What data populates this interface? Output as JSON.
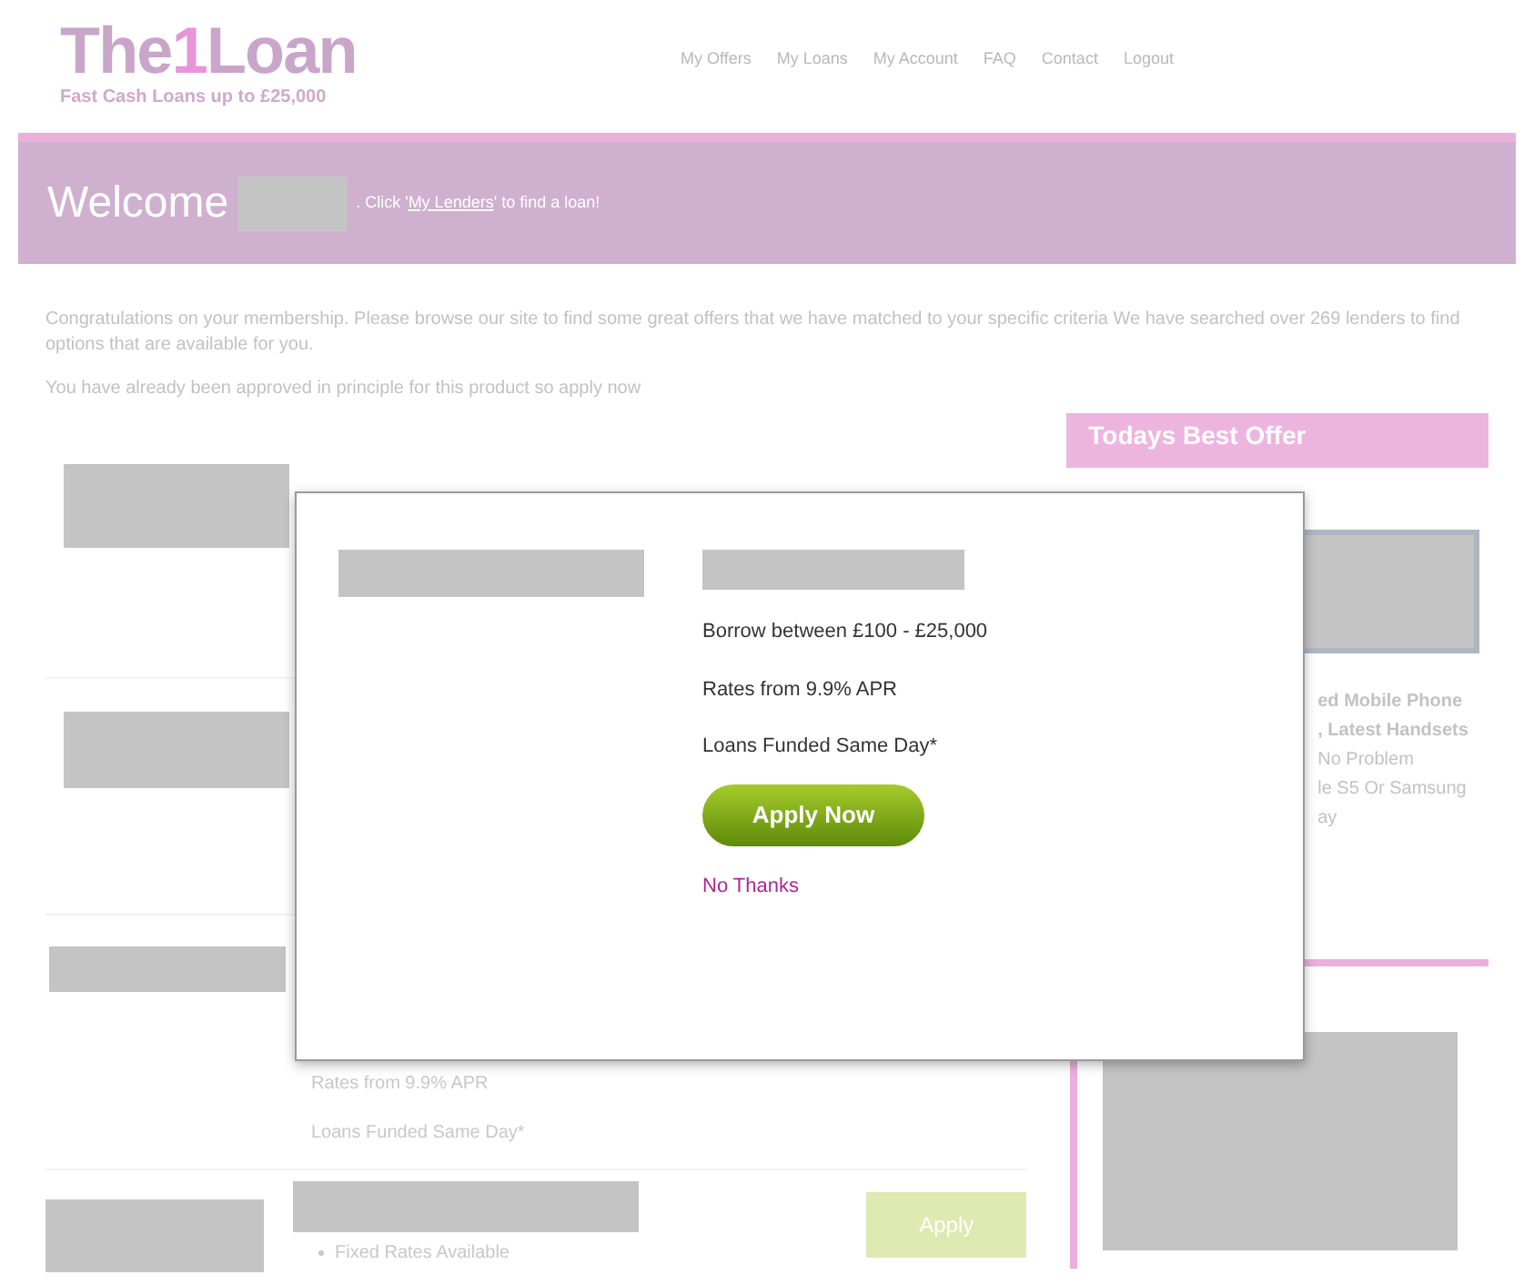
{
  "header": {
    "logo": {
      "before": "The",
      "digit": "1",
      "after": "Loan"
    },
    "tagline": "Fast Cash Loans up to £25,000",
    "nav": [
      "My Offers",
      "My Loans",
      "My Account",
      "FAQ",
      "Contact",
      "Logout"
    ]
  },
  "banner": {
    "welcome": "Welcome",
    "before": ". Click '",
    "link": "My Lenders",
    "after": "' to find a loan!"
  },
  "intro": [
    "Congratulations on your membership. Please browse our site to find some great offers that we have matched to your specific criteria We have searched over 269 lenders to find options that are available for you.",
    "You have already been approved in principle for this product so apply now"
  ],
  "offers": [
    {
      "lines": [
        "Rates from 9.9% APR",
        "Loans Funded Same Day*"
      ]
    },
    {
      "bullets": [
        "Fixed Rates Available"
      ],
      "button": "Apply"
    }
  ],
  "sidebar": {
    "title": "Todays Best Offer",
    "lines": [
      "ed Mobile Phone",
      ", Latest Handsets",
      "No Problem",
      "le S5 Or Samsung",
      "ay"
    ]
  },
  "modal": {
    "lines": [
      "Borrow between £100 - £25,000",
      "Rates from 9.9% APR",
      "Loans Funded Same Day*"
    ],
    "button": "Apply Now",
    "dismiss": "No Thanks"
  }
}
